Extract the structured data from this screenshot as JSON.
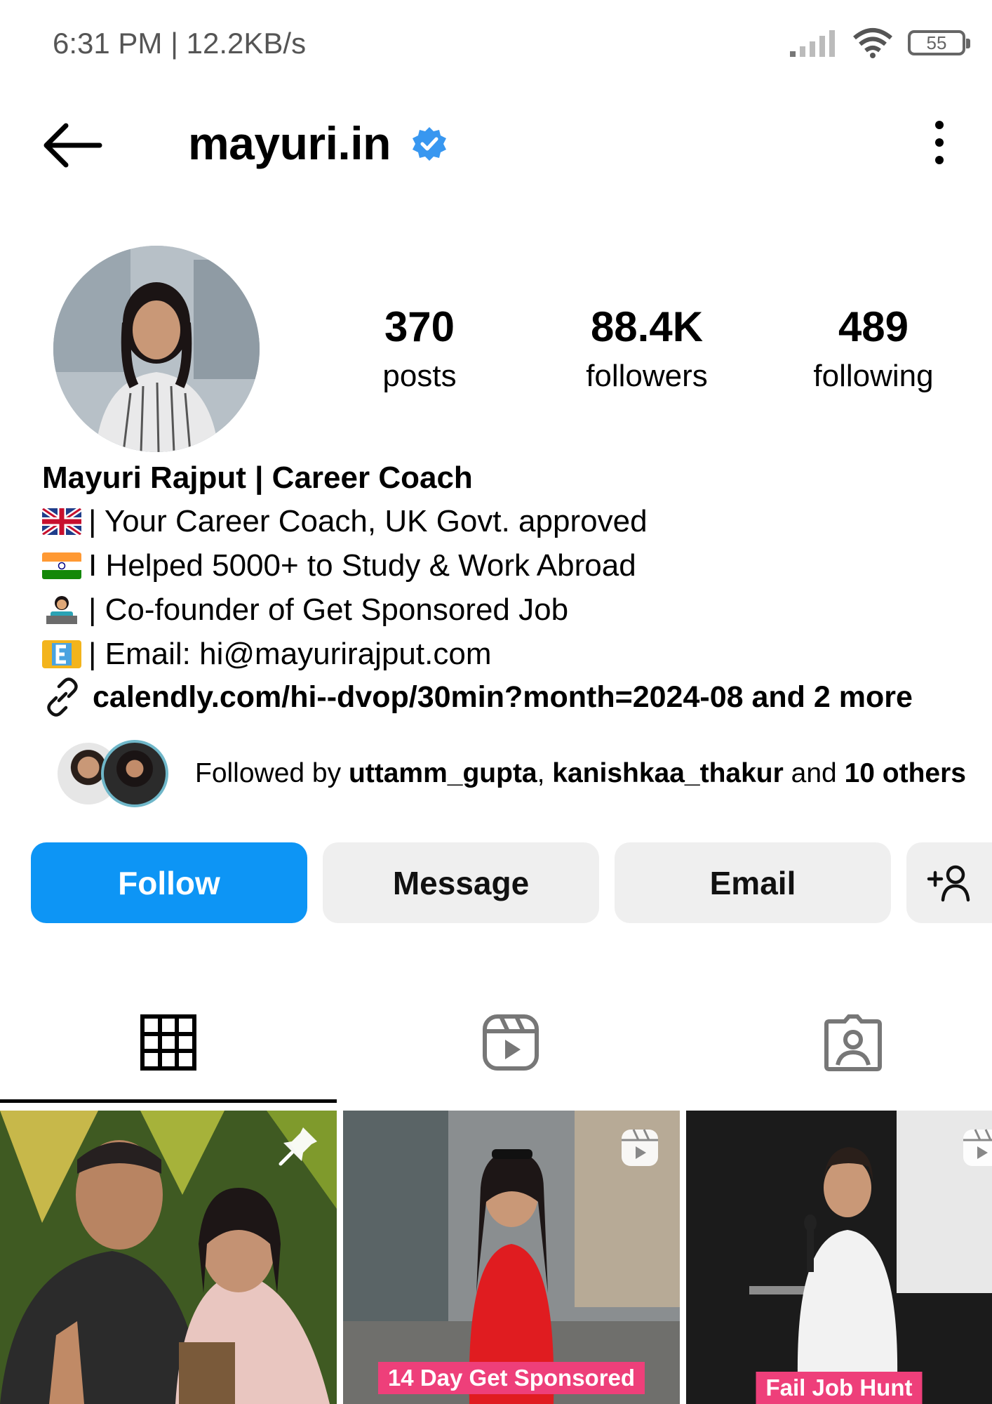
{
  "status_bar": {
    "time_speed": "6:31 PM | 12.2KB/s",
    "battery": "55"
  },
  "header": {
    "username": "mayuri.in"
  },
  "stats": [
    {
      "value": "370",
      "label": "posts"
    },
    {
      "value": "88.4K",
      "label": "followers"
    },
    {
      "value": "489",
      "label": "following"
    }
  ],
  "bio": {
    "name": "Mayuri Rajput | Career Coach",
    "lines": [
      "| Your Career Coach, UK Govt. approved",
      "I Helped 5000+ to Study & Work Abroad",
      "| Co-founder of Get Sponsored Job",
      "| Email: hi@mayurirajput.com"
    ],
    "link": "calendly.com/hi--dvop/30min?month=2024-08 and 2 more"
  },
  "followed_by": {
    "prefix": "Followed by ",
    "user1": "uttamm_gupta",
    "sep": ", ",
    "user2": "kanishkaa_thakur",
    "and": " and ",
    "others": "10 others"
  },
  "buttons": {
    "follow": "Follow",
    "message": "Message",
    "email": "Email"
  },
  "posts": [
    {
      "caption": ""
    },
    {
      "caption": "14 Day Get Sponsored"
    },
    {
      "caption": "Fail Job Hunt"
    }
  ],
  "colors": {
    "accent": "#0d95f5",
    "verified": "#3897f0",
    "caption_bg": "#ee3f7a"
  }
}
